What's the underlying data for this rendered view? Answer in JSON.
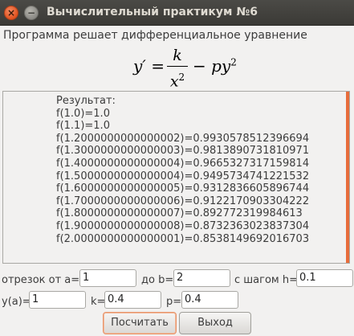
{
  "window": {
    "title": "Вычислительный практикум №6",
    "close_glyph": "×",
    "minimize_glyph": "−"
  },
  "description": "Программа решает дифференциальное уравнение",
  "formula": {
    "lhs": "y′ = ",
    "numerator": "k",
    "denominator": "x",
    "denominator_power": "2",
    "rhs_main": "− py",
    "rhs_power": "2"
  },
  "result": {
    "lines": [
      "Результат:",
      "f(1.0)=1.0",
      "f(1.1)=1.0",
      "f(1.2000000000000002)=0.9930578512396694",
      "f(1.3000000000000003)=0.9813890731810971",
      "f(1.4000000000000004)=0.9665327317159814",
      "f(1.5000000000000004)=0.9495734741221532",
      "f(1.6000000000000005)=0.9312836605896744",
      "f(1.7000000000000006)=0.9122170903304222",
      "f(1.8000000000000007)=0.892772319984613",
      "f(1.9000000000000008)=0.8732363023837304",
      "f(2.0000000000000001)=0.8538149692016703"
    ]
  },
  "params": {
    "segment_label": "отрезок от a=",
    "a_value": "1",
    "to_label": "до b=",
    "b_value": "2",
    "step_label": "с шагом h=",
    "h_value": "0.1",
    "ya_label": "y(a)=",
    "ya_value": "1",
    "k_label": "k=",
    "k_value": "0.4",
    "p_label": "p=",
    "p_value": "0.4"
  },
  "buttons": {
    "compute": "Посчитать",
    "exit": "Выход"
  },
  "colors": {
    "accent": "#e86d3b",
    "titlebar": "#3c3b37"
  }
}
